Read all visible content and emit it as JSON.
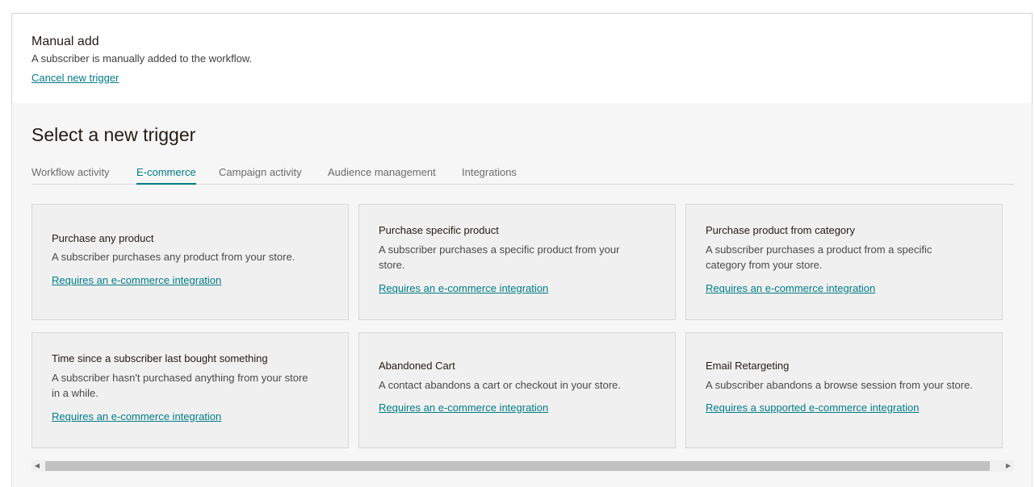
{
  "current_trigger": {
    "title": "Manual add",
    "description": "A subscriber is manually added to the workflow.",
    "cancel_link": "Cancel new trigger"
  },
  "selector": {
    "title": "Select a new trigger",
    "tabs": [
      {
        "label": "Workflow activity",
        "active": false
      },
      {
        "label": "E-commerce",
        "active": true
      },
      {
        "label": "Campaign activity",
        "active": false
      },
      {
        "label": "Audience management",
        "active": false
      },
      {
        "label": "Integrations",
        "active": false
      }
    ],
    "cards": [
      {
        "title": "Purchase any product",
        "description": "A subscriber purchases any product from your store.",
        "link": "Requires an e-commerce integration"
      },
      {
        "title": "Purchase specific product",
        "description": "A subscriber purchases a specific product from your store.",
        "link": "Requires an e-commerce integration"
      },
      {
        "title": "Purchase product from category",
        "description": "A subscriber purchases a product from a specific category from your store.",
        "link": "Requires an e-commerce integration"
      },
      {
        "title": "Time since a subscriber last bought something",
        "description": "A subscriber hasn't purchased anything from your store in a while.",
        "link": "Requires an e-commerce integration"
      },
      {
        "title": "Abandoned Cart",
        "description": "A contact abandons a cart or checkout in your store.",
        "link": "Requires an e-commerce integration"
      },
      {
        "title": "Email Retargeting",
        "description": "A subscriber abandons a browse session from your store.",
        "link": "Requires a supported e-commerce integration"
      }
    ]
  },
  "scrollbar": {
    "left_arrow": "◀",
    "right_arrow": "▶"
  },
  "colors": {
    "accent": "#007c89",
    "panel_background": "#f6f6f6",
    "card_background": "#f0f0f0"
  }
}
